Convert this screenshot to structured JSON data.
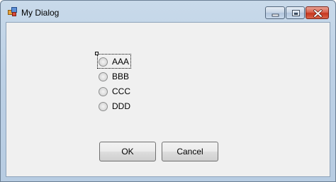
{
  "window": {
    "title": "My Dialog"
  },
  "options": [
    {
      "label": "AAA",
      "checked": false,
      "focused": true
    },
    {
      "label": "BBB",
      "checked": false
    },
    {
      "label": "CCC",
      "checked": false
    },
    {
      "label": "DDD",
      "checked": false
    }
  ],
  "buttons": {
    "ok_label": "OK",
    "cancel_label": "Cancel"
  },
  "colors": {
    "client_background": "#f0f0f0",
    "close_button": "#c7371e",
    "title_bar": "#bcd0e5"
  },
  "icons": {
    "app": "app-icon",
    "minimize": "minimize-icon",
    "maximize": "maximize-icon",
    "close": "close-icon"
  }
}
